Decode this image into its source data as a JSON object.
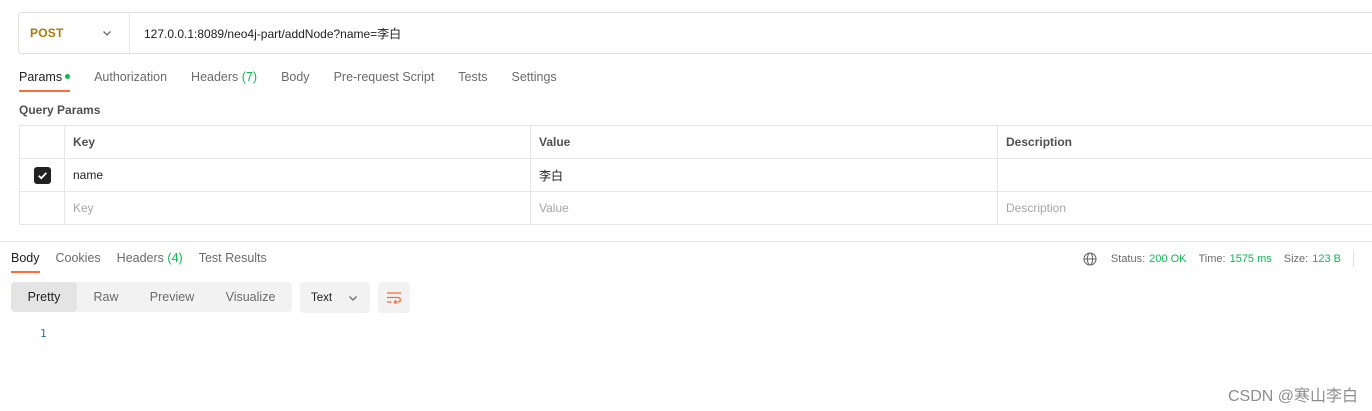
{
  "request": {
    "method": "POST",
    "url": "127.0.0.1:8089/neo4j-part/addNode?name=李白"
  },
  "request_tabs": [
    {
      "label": "Params",
      "active": true,
      "dot": true
    },
    {
      "label": "Authorization"
    },
    {
      "label": "Headers",
      "count": "(7)"
    },
    {
      "label": "Body"
    },
    {
      "label": "Pre-request Script"
    },
    {
      "label": "Tests"
    },
    {
      "label": "Settings"
    }
  ],
  "query_params": {
    "title": "Query Params",
    "columns": [
      "Key",
      "Value",
      "Description"
    ],
    "rows": [
      {
        "checked": true,
        "key": "name",
        "value": "李白",
        "description": ""
      }
    ],
    "placeholder": {
      "key": "Key",
      "value": "Value",
      "description": "Description"
    }
  },
  "response_tabs": [
    {
      "label": "Body",
      "active": true
    },
    {
      "label": "Cookies"
    },
    {
      "label": "Headers",
      "count": "(4)"
    },
    {
      "label": "Test Results"
    }
  ],
  "status": {
    "status_label": "Status:",
    "status_value": "200 OK",
    "time_label": "Time:",
    "time_value": "1575 ms",
    "size_label": "Size:",
    "size_value": "123 B"
  },
  "view_modes": [
    {
      "label": "Pretty",
      "active": true
    },
    {
      "label": "Raw"
    },
    {
      "label": "Preview"
    },
    {
      "label": "Visualize"
    }
  ],
  "format": {
    "selected": "Text"
  },
  "body_lines": [
    "1"
  ],
  "watermark": "CSDN @寒山李白",
  "colors": {
    "accent": "#ff6c37",
    "method_post": "#ad7a03",
    "success": "#0cbb52",
    "line_number": "#2a7a9e"
  },
  "icons": {
    "method_dropdown": "chevron-down-icon",
    "format_dropdown": "chevron-down-icon",
    "network": "globe-icon",
    "wrap": "wrap-lines-icon",
    "checkbox": "checkmark-icon"
  }
}
